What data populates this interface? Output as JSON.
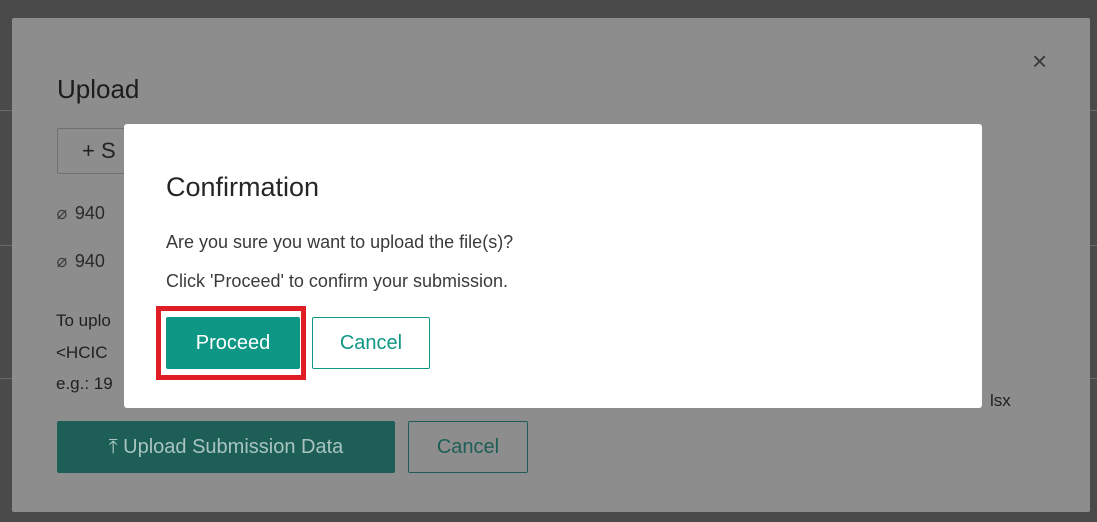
{
  "upload_dialog": {
    "title": "Upload",
    "close_icon": "×",
    "select_button": "+ S",
    "files": [
      "940",
      "940"
    ],
    "hint_lines": [
      "To uplo",
      "<HCIC",
      "e.g.: 19"
    ],
    "hint_tail": "lsx",
    "upload_button": "⤒ Upload Submission Data",
    "cancel_button": "Cancel"
  },
  "confirmation": {
    "title": "Confirmation",
    "message_line1": "Are you sure you want to upload the file(s)?",
    "message_line2": "Click 'Proceed' to confirm your submission.",
    "proceed_button": "Proceed",
    "cancel_button": "Cancel",
    "highlight_color": "#e01c24",
    "accent_color": "#0f9785"
  }
}
